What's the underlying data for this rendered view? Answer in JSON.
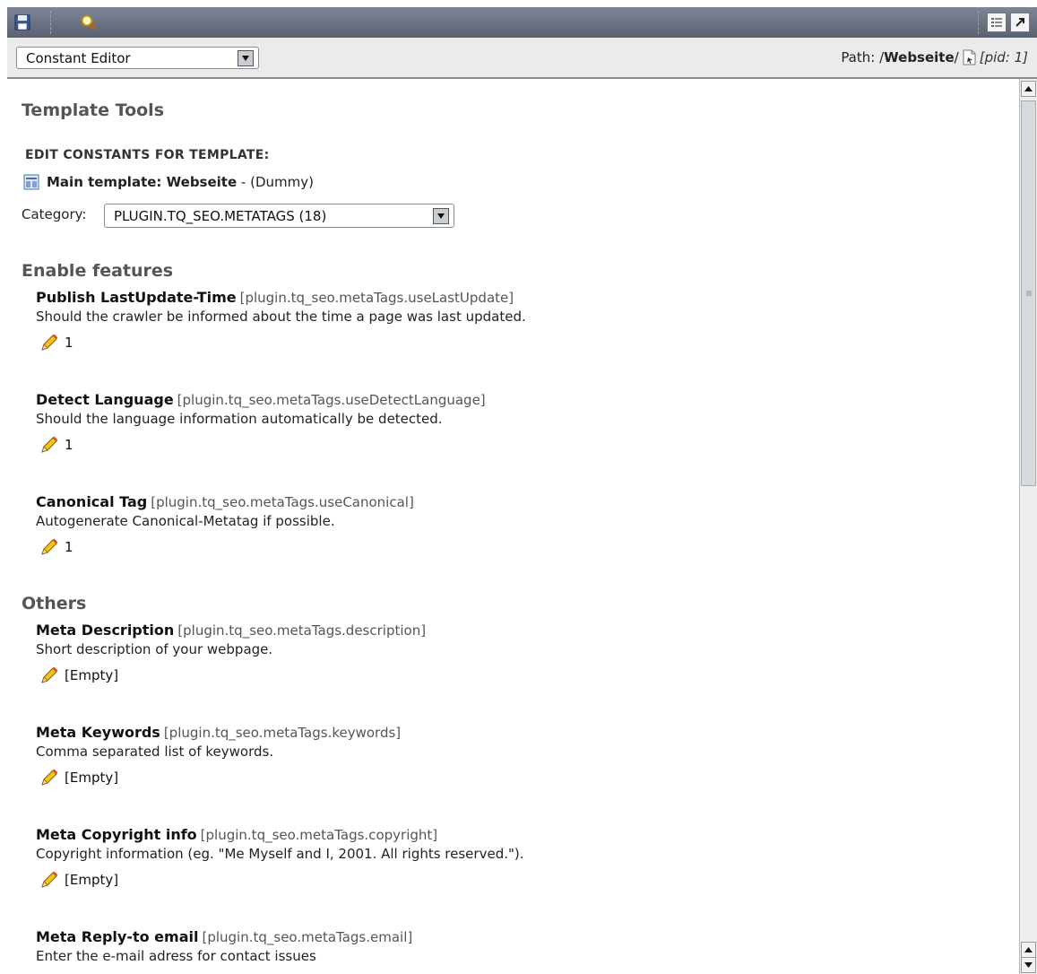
{
  "toolbar": {
    "save_icon": "save-icon",
    "search_icon": "search-icon",
    "list_icon": "list-view-icon",
    "newwin_icon": "open-new-window-icon"
  },
  "function_menu": {
    "selected": "Constant Editor"
  },
  "path": {
    "label": "Path: /",
    "page": "Webseite",
    "sep": "/",
    "pid": "[pid: 1]"
  },
  "title": "Template Tools",
  "edit_heading": "EDIT CONSTANTS FOR TEMPLATE:",
  "template": {
    "label": "Main template: Webseite",
    "suffix": " - (Dummy)"
  },
  "category": {
    "label": "Category:",
    "selected": "PLUGIN.TQ_SEO.METATAGS (18)"
  },
  "sections": [
    {
      "title": "Enable features",
      "entries": [
        {
          "title": "Publish LastUpdate-Time",
          "key": "[plugin.tq_seo.metaTags.useLastUpdate]",
          "desc": "Should the crawler be informed about the time a page was last updated.",
          "value": "1"
        },
        {
          "title": "Detect Language",
          "key": "[plugin.tq_seo.metaTags.useDetectLanguage]",
          "desc": "Should the language information automatically be detected.",
          "value": "1"
        },
        {
          "title": "Canonical Tag",
          "key": "[plugin.tq_seo.metaTags.useCanonical]",
          "desc": "Autogenerate Canonical-Metatag if possible.",
          "value": "1"
        }
      ]
    },
    {
      "title": "Others",
      "entries": [
        {
          "title": "Meta Description",
          "key": "[plugin.tq_seo.metaTags.description]",
          "desc": "Short description of your webpage.",
          "value": "[Empty]"
        },
        {
          "title": "Meta Keywords",
          "key": "[plugin.tq_seo.metaTags.keywords]",
          "desc": "Comma separated list of keywords.",
          "value": "[Empty]"
        },
        {
          "title": "Meta Copyright info",
          "key": "[plugin.tq_seo.metaTags.copyright]",
          "desc": "Copyright information (eg. \"Me Myself and I, 2001. All rights reserved.\").",
          "value": "[Empty]"
        },
        {
          "title": "Meta Reply-to email",
          "key": "[plugin.tq_seo.metaTags.email]",
          "desc": "Enter the e-mail adress for contact issues",
          "value": ""
        }
      ]
    }
  ]
}
